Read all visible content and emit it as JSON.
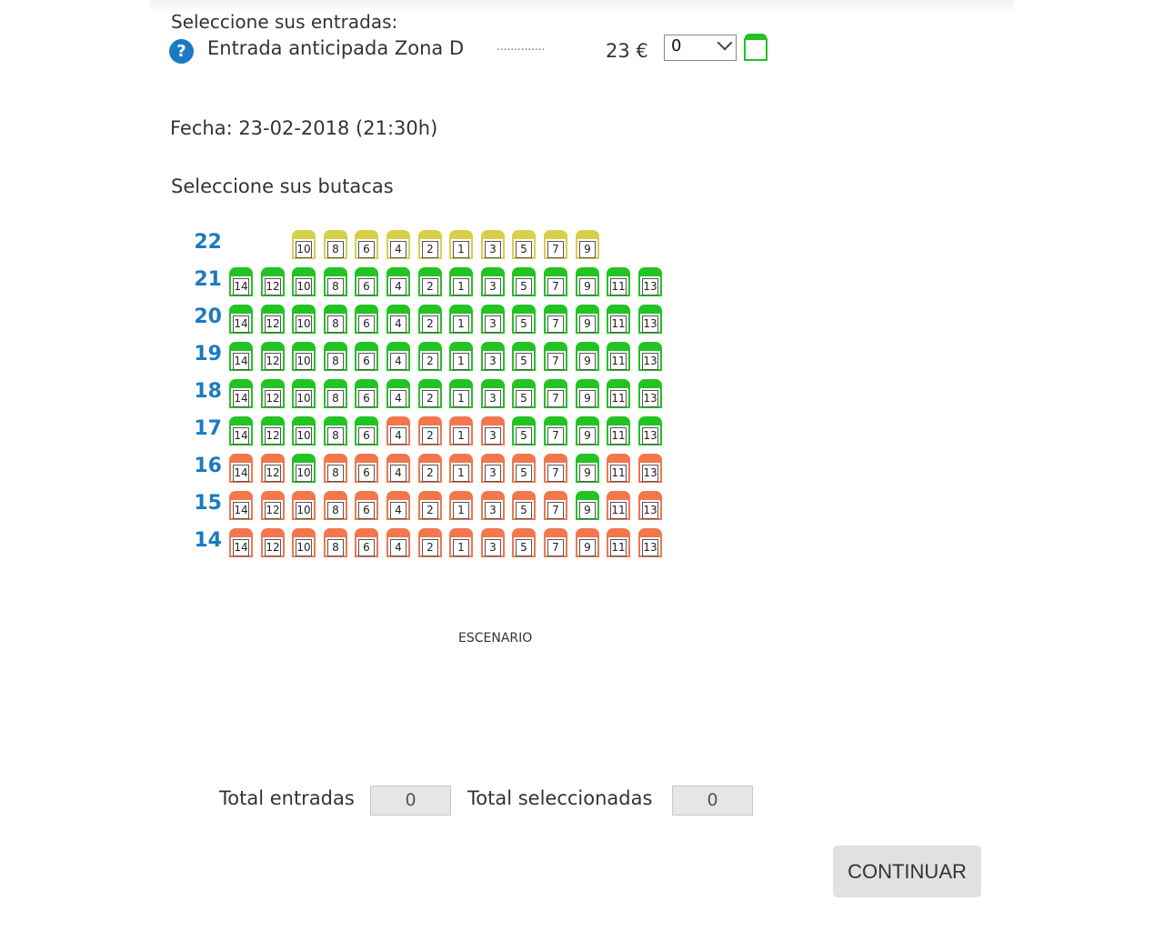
{
  "ticket_section": {
    "heading": "Seleccione sus entradas:",
    "help_icon": "question-icon",
    "help_symbol": "?",
    "ticket_name": "Entrada anticipada Zona D",
    "dots": "..............",
    "price": "23 €",
    "quantity_value": "0"
  },
  "fecha": "Fecha: 23-02-2018 (21:30h)",
  "seats_heading": "Seleccione sus butacas",
  "colors": {
    "available": "#22c322",
    "occupied": "#f2774c",
    "reserved": "#d8cf4a",
    "row_label": "#1a7bc0"
  },
  "seat_order": [
    "14",
    "12",
    "10",
    "8",
    "6",
    "4",
    "2",
    "1",
    "3",
    "5",
    "7",
    "9",
    "11",
    "13"
  ],
  "rows": [
    {
      "label": "22",
      "seats": [
        {
          "n": "10",
          "s": "reserved"
        },
        {
          "n": "8",
          "s": "reserved"
        },
        {
          "n": "6",
          "s": "reserved"
        },
        {
          "n": "4",
          "s": "reserved"
        },
        {
          "n": "2",
          "s": "reserved"
        },
        {
          "n": "1",
          "s": "reserved"
        },
        {
          "n": "3",
          "s": "reserved"
        },
        {
          "n": "5",
          "s": "reserved"
        },
        {
          "n": "7",
          "s": "reserved"
        },
        {
          "n": "9",
          "s": "reserved"
        }
      ]
    },
    {
      "label": "21",
      "seats": [
        {
          "n": "14",
          "s": "available"
        },
        {
          "n": "12",
          "s": "available"
        },
        {
          "n": "10",
          "s": "available"
        },
        {
          "n": "8",
          "s": "available"
        },
        {
          "n": "6",
          "s": "available"
        },
        {
          "n": "4",
          "s": "available"
        },
        {
          "n": "2",
          "s": "available"
        },
        {
          "n": "1",
          "s": "available"
        },
        {
          "n": "3",
          "s": "available"
        },
        {
          "n": "5",
          "s": "available"
        },
        {
          "n": "7",
          "s": "available"
        },
        {
          "n": "9",
          "s": "available"
        },
        {
          "n": "11",
          "s": "available"
        },
        {
          "n": "13",
          "s": "available"
        }
      ]
    },
    {
      "label": "20",
      "seats": [
        {
          "n": "14",
          "s": "available"
        },
        {
          "n": "12",
          "s": "available"
        },
        {
          "n": "10",
          "s": "available"
        },
        {
          "n": "8",
          "s": "available"
        },
        {
          "n": "6",
          "s": "available"
        },
        {
          "n": "4",
          "s": "available"
        },
        {
          "n": "2",
          "s": "available"
        },
        {
          "n": "1",
          "s": "available"
        },
        {
          "n": "3",
          "s": "available"
        },
        {
          "n": "5",
          "s": "available"
        },
        {
          "n": "7",
          "s": "available"
        },
        {
          "n": "9",
          "s": "available"
        },
        {
          "n": "11",
          "s": "available"
        },
        {
          "n": "13",
          "s": "available"
        }
      ]
    },
    {
      "label": "19",
      "seats": [
        {
          "n": "14",
          "s": "available"
        },
        {
          "n": "12",
          "s": "available"
        },
        {
          "n": "10",
          "s": "available"
        },
        {
          "n": "8",
          "s": "available"
        },
        {
          "n": "6",
          "s": "available"
        },
        {
          "n": "4",
          "s": "available"
        },
        {
          "n": "2",
          "s": "available"
        },
        {
          "n": "1",
          "s": "available"
        },
        {
          "n": "3",
          "s": "available"
        },
        {
          "n": "5",
          "s": "available"
        },
        {
          "n": "7",
          "s": "available"
        },
        {
          "n": "9",
          "s": "available"
        },
        {
          "n": "11",
          "s": "available"
        },
        {
          "n": "13",
          "s": "available"
        }
      ]
    },
    {
      "label": "18",
      "seats": [
        {
          "n": "14",
          "s": "available"
        },
        {
          "n": "12",
          "s": "available"
        },
        {
          "n": "10",
          "s": "available"
        },
        {
          "n": "8",
          "s": "available"
        },
        {
          "n": "6",
          "s": "available"
        },
        {
          "n": "4",
          "s": "available"
        },
        {
          "n": "2",
          "s": "available"
        },
        {
          "n": "1",
          "s": "available"
        },
        {
          "n": "3",
          "s": "available"
        },
        {
          "n": "5",
          "s": "available"
        },
        {
          "n": "7",
          "s": "available"
        },
        {
          "n": "9",
          "s": "available"
        },
        {
          "n": "11",
          "s": "available"
        },
        {
          "n": "13",
          "s": "available"
        }
      ]
    },
    {
      "label": "17",
      "seats": [
        {
          "n": "14",
          "s": "available"
        },
        {
          "n": "12",
          "s": "available"
        },
        {
          "n": "10",
          "s": "available"
        },
        {
          "n": "8",
          "s": "available"
        },
        {
          "n": "6",
          "s": "available"
        },
        {
          "n": "4",
          "s": "occupied"
        },
        {
          "n": "2",
          "s": "occupied"
        },
        {
          "n": "1",
          "s": "occupied"
        },
        {
          "n": "3",
          "s": "occupied"
        },
        {
          "n": "5",
          "s": "available"
        },
        {
          "n": "7",
          "s": "available"
        },
        {
          "n": "9",
          "s": "available"
        },
        {
          "n": "11",
          "s": "available"
        },
        {
          "n": "13",
          "s": "available"
        }
      ]
    },
    {
      "label": "16",
      "seats": [
        {
          "n": "14",
          "s": "occupied"
        },
        {
          "n": "12",
          "s": "occupied"
        },
        {
          "n": "10",
          "s": "available"
        },
        {
          "n": "8",
          "s": "occupied"
        },
        {
          "n": "6",
          "s": "occupied"
        },
        {
          "n": "4",
          "s": "occupied"
        },
        {
          "n": "2",
          "s": "occupied"
        },
        {
          "n": "1",
          "s": "occupied"
        },
        {
          "n": "3",
          "s": "occupied"
        },
        {
          "n": "5",
          "s": "occupied"
        },
        {
          "n": "7",
          "s": "occupied"
        },
        {
          "n": "9",
          "s": "available"
        },
        {
          "n": "11",
          "s": "occupied"
        },
        {
          "n": "13",
          "s": "occupied"
        }
      ]
    },
    {
      "label": "15",
      "seats": [
        {
          "n": "14",
          "s": "occupied"
        },
        {
          "n": "12",
          "s": "occupied"
        },
        {
          "n": "10",
          "s": "occupied"
        },
        {
          "n": "8",
          "s": "occupied"
        },
        {
          "n": "6",
          "s": "occupied"
        },
        {
          "n": "4",
          "s": "occupied"
        },
        {
          "n": "2",
          "s": "occupied"
        },
        {
          "n": "1",
          "s": "occupied"
        },
        {
          "n": "3",
          "s": "occupied"
        },
        {
          "n": "5",
          "s": "occupied"
        },
        {
          "n": "7",
          "s": "occupied"
        },
        {
          "n": "9",
          "s": "available"
        },
        {
          "n": "11",
          "s": "occupied"
        },
        {
          "n": "13",
          "s": "occupied"
        }
      ]
    },
    {
      "label": "14",
      "seats": [
        {
          "n": "14",
          "s": "occupied"
        },
        {
          "n": "12",
          "s": "occupied"
        },
        {
          "n": "10",
          "s": "occupied"
        },
        {
          "n": "8",
          "s": "occupied"
        },
        {
          "n": "6",
          "s": "occupied"
        },
        {
          "n": "4",
          "s": "occupied"
        },
        {
          "n": "2",
          "s": "occupied"
        },
        {
          "n": "1",
          "s": "occupied"
        },
        {
          "n": "3",
          "s": "occupied"
        },
        {
          "n": "5",
          "s": "occupied"
        },
        {
          "n": "7",
          "s": "occupied"
        },
        {
          "n": "9",
          "s": "occupied"
        },
        {
          "n": "11",
          "s": "occupied"
        },
        {
          "n": "13",
          "s": "occupied"
        }
      ]
    }
  ],
  "stage_label": "ESCENARIO",
  "totals": {
    "entradas_label": "Total entradas",
    "entradas_value": "0",
    "seleccionadas_label": "Total seleccionadas",
    "seleccionadas_value": "0"
  },
  "continue_button": "CONTINUAR"
}
